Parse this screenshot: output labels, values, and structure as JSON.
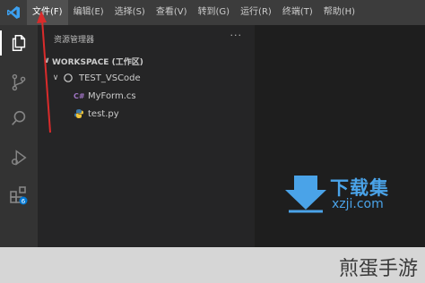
{
  "menubar": {
    "items": [
      {
        "label": "文件(F)"
      },
      {
        "label": "编辑(E)"
      },
      {
        "label": "选择(S)"
      },
      {
        "label": "查看(V)"
      },
      {
        "label": "转到(G)"
      },
      {
        "label": "运行(R)"
      },
      {
        "label": "终端(T)"
      },
      {
        "label": "帮助(H)"
      }
    ]
  },
  "sidebar": {
    "title": "资源管理器",
    "more": "···",
    "workspace": "WORKSPACE (工作区)",
    "folder": "TEST_VSCode",
    "files": [
      {
        "name": "MyForm.cs",
        "icon": "csharp-file-icon"
      },
      {
        "name": "test.py",
        "icon": "python-file-icon"
      }
    ]
  },
  "watermark": {
    "name": "下载集",
    "url": "xzji.com"
  },
  "caption": "煎蛋手游",
  "colors": {
    "accent": "#0078d4",
    "watermark": "#4aa3e8",
    "arrow": "#d92b2b"
  }
}
